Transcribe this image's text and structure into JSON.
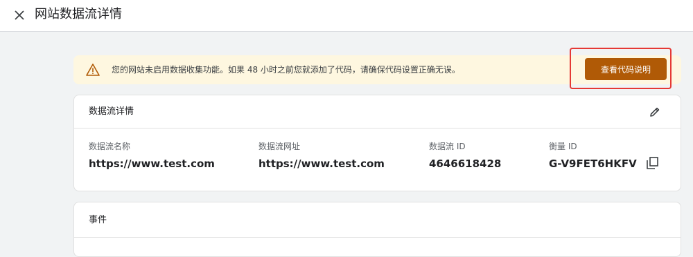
{
  "header": {
    "title": "网站数据流详情"
  },
  "banner": {
    "message": "您的网站未启用数据收集功能。如果 48 小时之前您就添加了代码，请确保代码设置正确无误。",
    "button_label": "查看代码说明",
    "accent_color": "#b05a06",
    "background_color": "#fef7e0"
  },
  "stream_details": {
    "title": "数据流详情",
    "fields": [
      {
        "label": "数据流名称",
        "value": "https://www.test.com"
      },
      {
        "label": "数据流网址",
        "value": "https://www.test.com"
      },
      {
        "label": "数据流 ID",
        "value": "4646618428"
      },
      {
        "label": "衡量 ID",
        "value": "G-V9FET6HKFV"
      }
    ]
  },
  "events": {
    "title": "事件"
  },
  "icons": {
    "close": "close-icon",
    "warning": "warning-icon",
    "edit": "pencil-icon",
    "copy": "copy-icon"
  }
}
